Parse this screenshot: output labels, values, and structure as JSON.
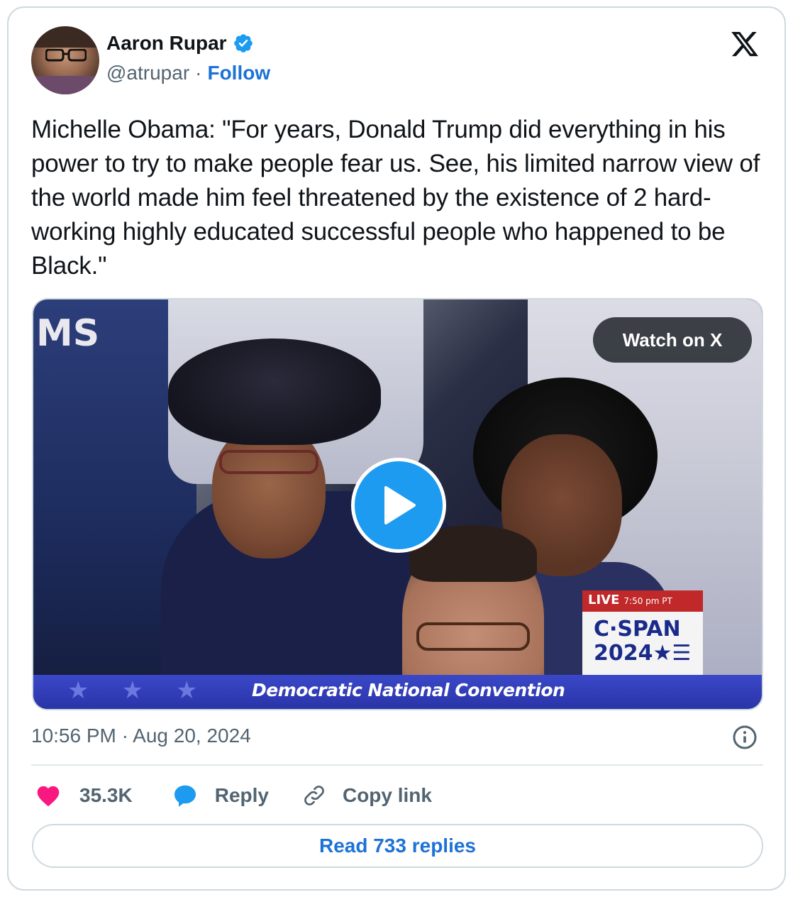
{
  "author": {
    "name": "Aaron Rupar",
    "handle": "@atrupar",
    "separator": "·",
    "follow_label": "Follow",
    "verified": true
  },
  "platform_logo": "x-logo-icon",
  "tweet": {
    "text": "Michelle Obama: \"For years, Donald Trump did everything in his power to try to make people fear us. See, his limited narrow view of the world made him feel threatened by the existence of 2 hard-working highly educated successful people who happened to be Black.\""
  },
  "media": {
    "watch_label": "Watch on X",
    "banner_text": "Democratic National Convention",
    "corner_text": "MS",
    "cspan_live": "LIVE",
    "cspan_time": "7:50 pm PT",
    "cspan_name": "C·SPAN",
    "cspan_year": "2024★☰"
  },
  "timestamp": "10:56 PM · Aug 20, 2024",
  "actions": {
    "likes": "35.3K",
    "reply_label": "Reply",
    "copy_label": "Copy link"
  },
  "read_replies_label": "Read 733 replies",
  "colors": {
    "accent": "#1d9bf0",
    "link": "#1d72d6",
    "like": "#f91880",
    "muted": "#536471",
    "border": "#cfd9de"
  }
}
